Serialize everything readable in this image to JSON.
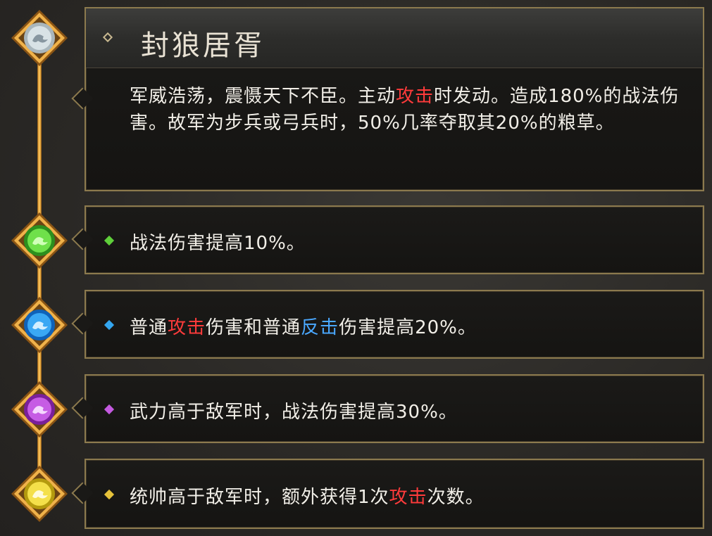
{
  "skill": {
    "title": "封狼居胥",
    "desc_parts": [
      "军威浩荡，震慑天下不臣。主动",
      "攻击",
      "时发动。造成180%的战法伤害。故军为步兵或弓兵时，50%几率夺取其20%的粮草。"
    ]
  },
  "effects": [
    {
      "color": "#5fcf3a",
      "parts": [
        "战法伤害提高10%。"
      ]
    },
    {
      "color": "#34a6f0",
      "parts": [
        "普通",
        "攻击",
        "伤害和普通",
        "反击",
        "伤害提高20%。"
      ]
    },
    {
      "color": "#c45ae0",
      "parts": [
        "武力高于敌军时，战法伤害提高30%。"
      ]
    },
    {
      "color": "#e6c23a",
      "parts": [
        "统帅高于敌军时，额外获得1次",
        "攻击",
        "次数。"
      ]
    }
  ],
  "colors": {
    "gold": "#e8a43a",
    "keyword_red": "#ff3b3b",
    "keyword_blue": "#4aa8ff",
    "text": "#f2efe8"
  },
  "icons": [
    "silver-dragon-gem-icon",
    "green-dragon-gem-icon",
    "blue-dragon-gem-icon",
    "purple-dragon-gem-icon",
    "yellow-dragon-gem-icon"
  ]
}
